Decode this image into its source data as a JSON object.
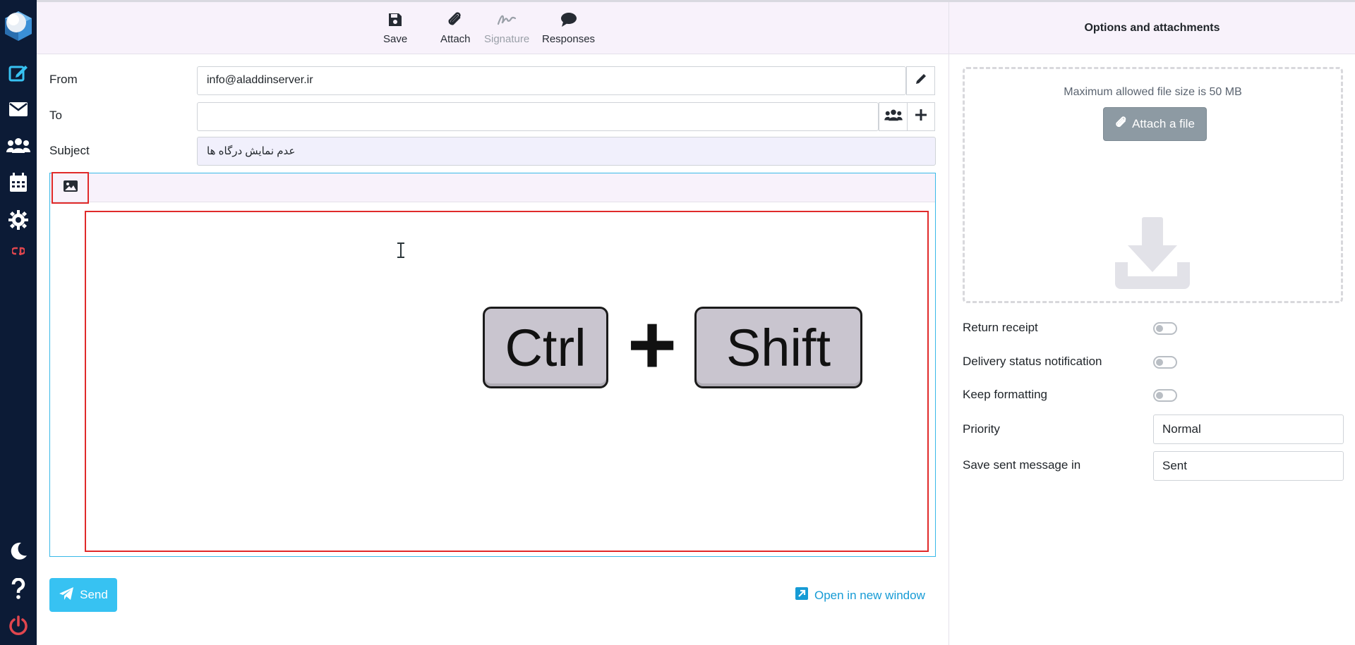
{
  "nav": {
    "items": [
      {
        "icon": "compose-icon",
        "active": true
      },
      {
        "icon": "mail-icon"
      },
      {
        "icon": "contacts-icon"
      },
      {
        "icon": "calendar-icon"
      },
      {
        "icon": "gear-icon"
      },
      {
        "icon": "cpanel-icon"
      },
      {
        "icon": "moon-icon"
      },
      {
        "icon": "help-icon"
      },
      {
        "icon": "power-icon"
      }
    ],
    "accent": "#e0464e",
    "background": "#0c1b36"
  },
  "toolbar": {
    "save_label": "Save",
    "attach_label": "Attach",
    "signature_label": "Signature",
    "responses_label": "Responses"
  },
  "compose": {
    "from_label": "From",
    "from_value": "info@aladdinserver.ir",
    "to_label": "To",
    "to_value": "",
    "subject_label": "Subject",
    "subject_value": "عدم نمایش درگاه ها"
  },
  "editor": {
    "key_ctrl": "Ctrl",
    "key_plus": "+",
    "key_shift": "Shift"
  },
  "footer": {
    "send_label": "Send",
    "open_new_window_label": "Open in new window"
  },
  "options": {
    "header": "Options and attachments",
    "max_size_note": "Maximum allowed file size is 50 MB",
    "attach_file_label": "Attach a file",
    "return_receipt_label": "Return receipt",
    "dsn_label": "Delivery status notification",
    "keep_formatting_label": "Keep formatting",
    "priority_label": "Priority",
    "priority_value": "Normal",
    "save_sent_label": "Save sent message in",
    "save_sent_value": "Sent",
    "return_receipt_on": false,
    "dsn_on": false,
    "keep_formatting_on": false
  },
  "colors": {
    "send_button": "#37c2f2",
    "link": "#169bd5",
    "highlight_box": "#e02a2a",
    "toolbar_bg": "#f8f2fb"
  }
}
